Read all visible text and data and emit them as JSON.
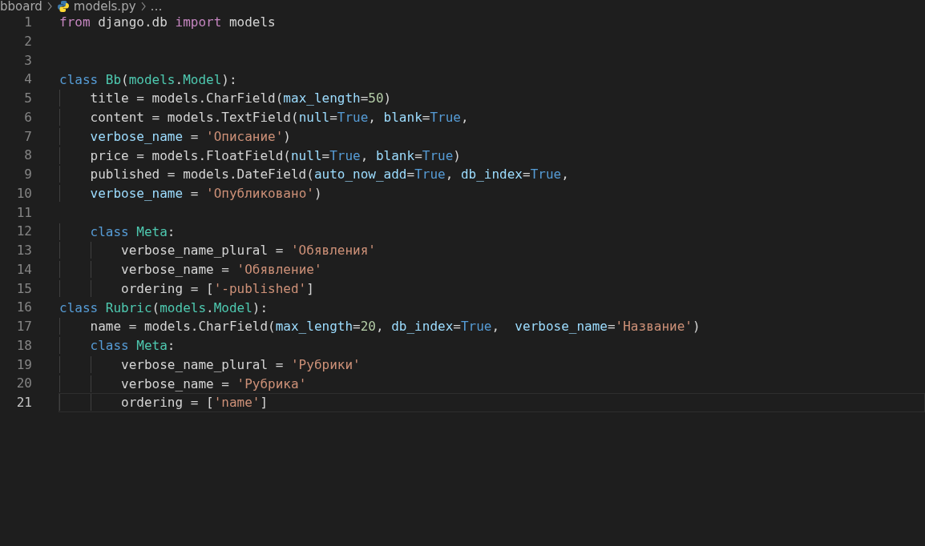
{
  "breadcrumb": {
    "folder": "bboard",
    "file": "models.py",
    "more": "…"
  },
  "editor": {
    "lines": [
      {
        "number": "1",
        "current": false,
        "tokens": [
          {
            "kind": "keyword",
            "text": "from"
          },
          {
            "kind": "plain",
            "text": " django.db "
          },
          {
            "kind": "keyword",
            "text": "import"
          },
          {
            "kind": "plain",
            "text": " models"
          }
        ]
      },
      {
        "number": "2",
        "current": false
      },
      {
        "number": "3",
        "current": false
      },
      {
        "number": "4",
        "current": false,
        "tokens": [
          {
            "kind": "storage",
            "text": "class "
          },
          {
            "kind": "type",
            "text": "Bb"
          },
          {
            "kind": "plain",
            "text": "("
          },
          {
            "kind": "type",
            "text": "models"
          },
          {
            "kind": "plain",
            "text": "."
          },
          {
            "kind": "type",
            "text": "Model"
          },
          {
            "kind": "plain",
            "text": "):"
          }
        ]
      },
      {
        "number": "5",
        "current": false,
        "tokens": [
          {
            "kind": "plain",
            "text": "    title = models.CharField("
          },
          {
            "kind": "param",
            "text": "max_length"
          },
          {
            "kind": "plain",
            "text": "="
          },
          {
            "kind": "number",
            "text": "50"
          },
          {
            "kind": "plain",
            "text": ")"
          }
        ]
      },
      {
        "number": "6",
        "current": false,
        "tokens": [
          {
            "kind": "plain",
            "text": "    content = models.TextField("
          },
          {
            "kind": "param",
            "text": "null"
          },
          {
            "kind": "plain",
            "text": "="
          },
          {
            "kind": "storage",
            "text": "True"
          },
          {
            "kind": "plain",
            "text": ", "
          },
          {
            "kind": "param",
            "text": "blank"
          },
          {
            "kind": "plain",
            "text": "="
          },
          {
            "kind": "storage",
            "text": "True"
          },
          {
            "kind": "plain",
            "text": ","
          }
        ]
      },
      {
        "number": "7",
        "current": false,
        "tokens": [
          {
            "kind": "param",
            "text": "    verbose_name"
          },
          {
            "kind": "plain",
            "text": " = "
          },
          {
            "kind": "string",
            "text": "'Описание'"
          },
          {
            "kind": "plain",
            "text": ")"
          }
        ]
      },
      {
        "number": "8",
        "current": false,
        "tokens": [
          {
            "kind": "plain",
            "text": "    price = models.FloatField("
          },
          {
            "kind": "param",
            "text": "null"
          },
          {
            "kind": "plain",
            "text": "="
          },
          {
            "kind": "storage",
            "text": "True"
          },
          {
            "kind": "plain",
            "text": ", "
          },
          {
            "kind": "param",
            "text": "blank"
          },
          {
            "kind": "plain",
            "text": "="
          },
          {
            "kind": "storage",
            "text": "True"
          },
          {
            "kind": "plain",
            "text": ")"
          }
        ]
      },
      {
        "number": "9",
        "current": false,
        "tokens": [
          {
            "kind": "plain",
            "text": "    published = models.DateField("
          },
          {
            "kind": "param",
            "text": "auto_now_add"
          },
          {
            "kind": "plain",
            "text": "="
          },
          {
            "kind": "storage",
            "text": "True"
          },
          {
            "kind": "plain",
            "text": ", "
          },
          {
            "kind": "param",
            "text": "db_index"
          },
          {
            "kind": "plain",
            "text": "="
          },
          {
            "kind": "storage",
            "text": "True"
          },
          {
            "kind": "plain",
            "text": ","
          }
        ]
      },
      {
        "number": "10",
        "current": false,
        "tokens": [
          {
            "kind": "param",
            "text": "    verbose_name"
          },
          {
            "kind": "plain",
            "text": " = "
          },
          {
            "kind": "string",
            "text": "'Опубликовано'"
          },
          {
            "kind": "plain",
            "text": ")"
          }
        ]
      },
      {
        "number": "11",
        "current": false
      },
      {
        "number": "12",
        "current": false,
        "tokens": [
          {
            "kind": "storage",
            "text": "    class "
          },
          {
            "kind": "type",
            "text": "Meta"
          },
          {
            "kind": "plain",
            "text": ":"
          }
        ]
      },
      {
        "number": "13",
        "current": false,
        "tokens": [
          {
            "kind": "plain",
            "text": "        verbose_name_plural = "
          },
          {
            "kind": "string",
            "text": "'Обявления'"
          }
        ]
      },
      {
        "number": "14",
        "current": false,
        "tokens": [
          {
            "kind": "plain",
            "text": "        verbose_name = "
          },
          {
            "kind": "string",
            "text": "'Обявление'"
          }
        ]
      },
      {
        "number": "15",
        "current": false,
        "tokens": [
          {
            "kind": "plain",
            "text": "        ordering = ["
          },
          {
            "kind": "string",
            "text": "'-published'"
          },
          {
            "kind": "plain",
            "text": "]"
          }
        ]
      },
      {
        "number": "16",
        "current": false,
        "tokens": [
          {
            "kind": "storage",
            "text": "class "
          },
          {
            "kind": "type",
            "text": "Rubric"
          },
          {
            "kind": "plain",
            "text": "("
          },
          {
            "kind": "type",
            "text": "models"
          },
          {
            "kind": "plain",
            "text": "."
          },
          {
            "kind": "type",
            "text": "Model"
          },
          {
            "kind": "plain",
            "text": "):"
          }
        ]
      },
      {
        "number": "17",
        "current": false,
        "tokens": [
          {
            "kind": "plain",
            "text": "    name = models.CharField("
          },
          {
            "kind": "param",
            "text": "max_length"
          },
          {
            "kind": "plain",
            "text": "="
          },
          {
            "kind": "number",
            "text": "20"
          },
          {
            "kind": "plain",
            "text": ", "
          },
          {
            "kind": "param",
            "text": "db_index"
          },
          {
            "kind": "plain",
            "text": "="
          },
          {
            "kind": "storage",
            "text": "True"
          },
          {
            "kind": "plain",
            "text": ",  "
          },
          {
            "kind": "param",
            "text": "verbose_name"
          },
          {
            "kind": "plain",
            "text": "="
          },
          {
            "kind": "string",
            "text": "'Название'"
          },
          {
            "kind": "plain",
            "text": ")"
          }
        ]
      },
      {
        "number": "18",
        "current": false,
        "tokens": [
          {
            "kind": "storage",
            "text": "    class "
          },
          {
            "kind": "type",
            "text": "Meta"
          },
          {
            "kind": "plain",
            "text": ":"
          }
        ]
      },
      {
        "number": "19",
        "current": false,
        "tokens": [
          {
            "kind": "plain",
            "text": "        verbose_name_plural = "
          },
          {
            "kind": "string",
            "text": "'Рубрики'"
          }
        ]
      },
      {
        "number": "20",
        "current": false,
        "tokens": [
          {
            "kind": "plain",
            "text": "        verbose_name = "
          },
          {
            "kind": "string",
            "text": "'Рубрика'"
          }
        ]
      },
      {
        "number": "21",
        "current": true,
        "tokens": [
          {
            "kind": "plain",
            "text": "        ordering = ["
          },
          {
            "kind": "string",
            "text": "'name'"
          },
          {
            "kind": "plain",
            "text": "]"
          }
        ]
      }
    ]
  }
}
